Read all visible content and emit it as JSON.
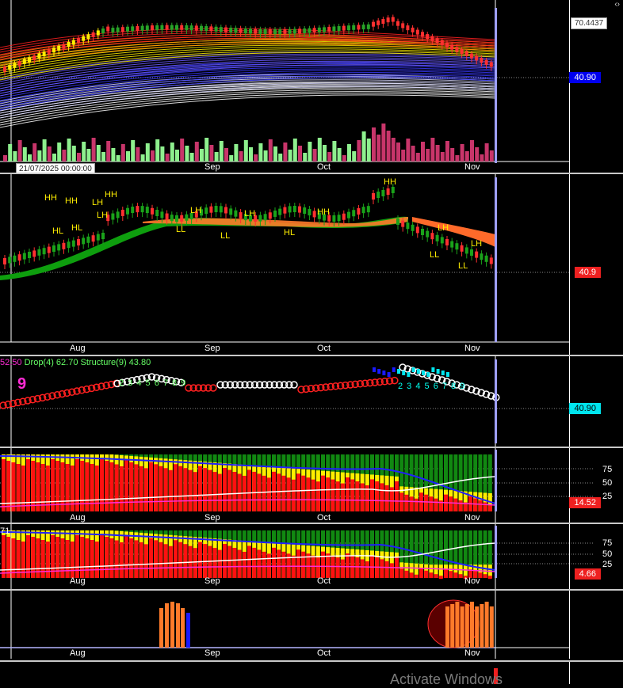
{
  "header": {
    "close_glyph": "‹›",
    "price_box": "70.4437"
  },
  "tooltip": "21/07/2025 00:00:00",
  "months": [
    "Aug",
    "Sep",
    "Oct",
    "Nov"
  ],
  "pane1": {
    "last_price": "40.90",
    "tag_color": "#0000ee"
  },
  "pane2": {
    "last_price": "40.9",
    "tag_color": "#ee2020",
    "labels": [
      "HH",
      "HH",
      "LH",
      "HH",
      "HL",
      "HL",
      "LH",
      "LH",
      "LH",
      "HH",
      "LL",
      "HL",
      "LL",
      "HH",
      "LH",
      "LH",
      "LL",
      "LL"
    ]
  },
  "pane3": {
    "legend": [
      "52.50",
      "Drop(4) 62.70",
      "Structure(9) 43.80"
    ],
    "big9": "9",
    "counts_left": "2 3 4 5 6 7 8 9",
    "counts_right": "2 3 4 5 6 7 8 9",
    "last_price": "40.90",
    "tag_color": "#00e5ee"
  },
  "pane4": {
    "levels": [
      "75",
      "50",
      "25"
    ],
    "value": "14.52",
    "tag_color": "#ee2020"
  },
  "pane5": {
    "levels": [
      "75",
      "50",
      "25"
    ],
    "value": "4.66",
    "top_label": "71",
    "tag_color": "#ee2020"
  },
  "watermark": "Activate Windows",
  "chart_data": {
    "type": "candlestick",
    "title": "",
    "x_ticks": [
      "Aug",
      "Sep",
      "Oct",
      "Nov"
    ],
    "y_last": 40.9,
    "y_marker": 70.4437,
    "oscillator_1_last": 14.52,
    "oscillator_2_last": 4.66,
    "oscillator_levels": [
      75,
      50,
      25
    ],
    "structure": {
      "drop": 62.7,
      "structure": 43.8,
      "prev": 52.5
    }
  }
}
